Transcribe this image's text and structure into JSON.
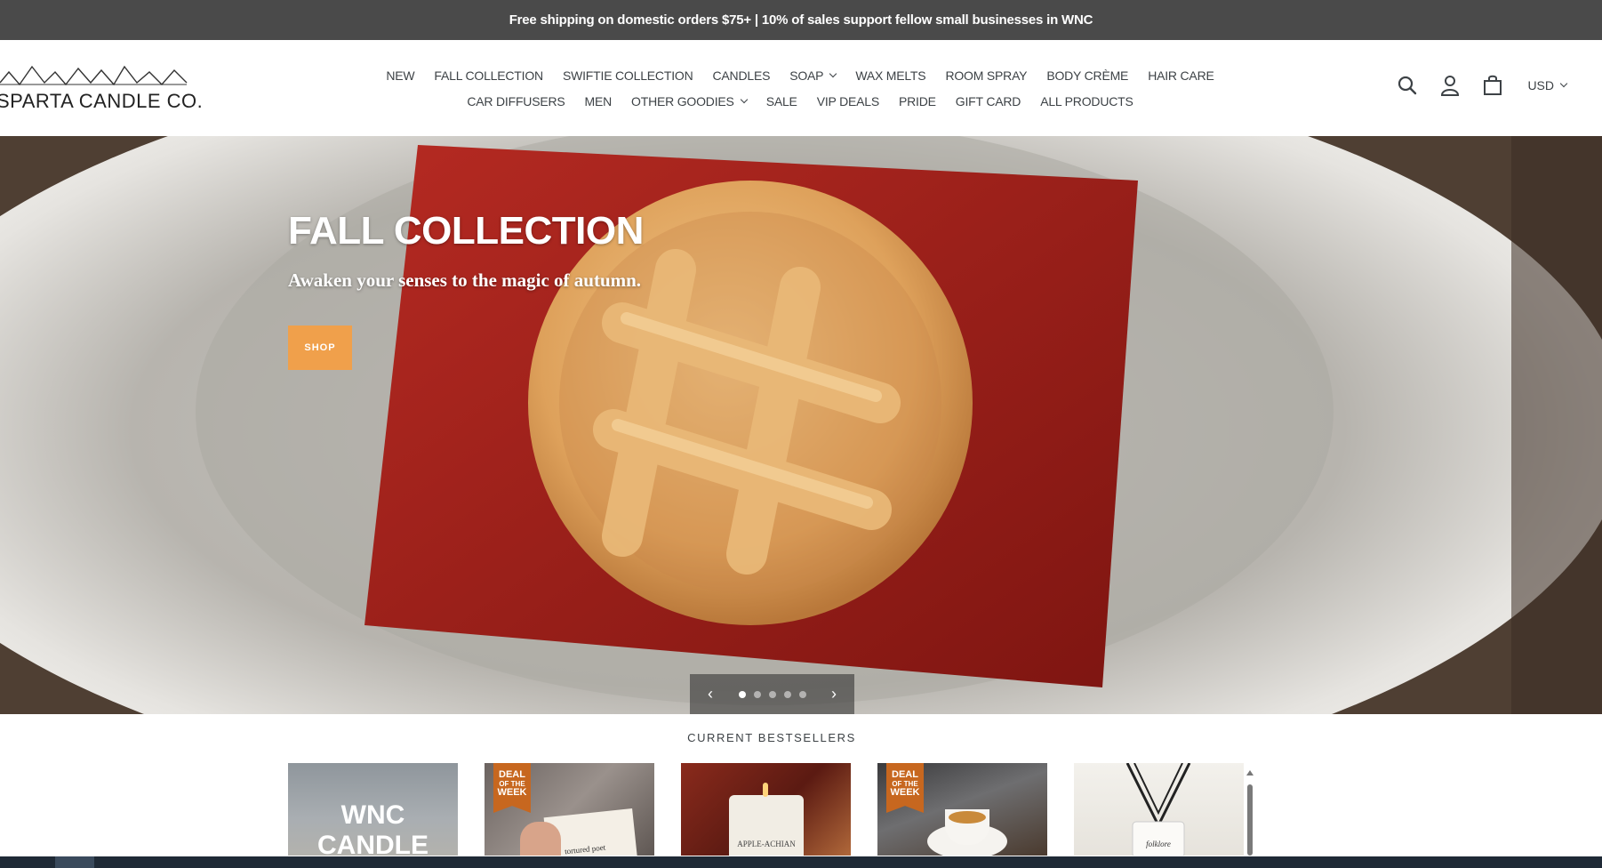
{
  "announcement": "Free shipping on domestic orders $75+ | 10% of sales support fellow small businesses in WNC",
  "brand": {
    "name": "SPARTA CANDLE CO."
  },
  "nav": {
    "row1": [
      {
        "label": "NEW",
        "dropdown": false
      },
      {
        "label": "FALL COLLECTION",
        "dropdown": false
      },
      {
        "label": "SWIFTIE COLLECTION",
        "dropdown": false
      },
      {
        "label": "CANDLES",
        "dropdown": false
      },
      {
        "label": "SOAP",
        "dropdown": true
      },
      {
        "label": "WAX MELTS",
        "dropdown": false
      },
      {
        "label": "ROOM SPRAY",
        "dropdown": false
      },
      {
        "label": "BODY CRÈME",
        "dropdown": false
      },
      {
        "label": "HAIR CARE",
        "dropdown": false
      }
    ],
    "row2": [
      {
        "label": "CAR DIFFUSERS",
        "dropdown": false
      },
      {
        "label": "MEN",
        "dropdown": false
      },
      {
        "label": "OTHER GOODIES",
        "dropdown": true
      },
      {
        "label": "SALE",
        "dropdown": false
      },
      {
        "label": "VIP DEALS",
        "dropdown": false
      },
      {
        "label": "PRIDE",
        "dropdown": false
      },
      {
        "label": "GIFT CARD",
        "dropdown": false
      },
      {
        "label": "ALL PRODUCTS",
        "dropdown": false
      }
    ]
  },
  "header_icons": [
    "search-icon",
    "account-icon",
    "cart-icon"
  ],
  "currency": "USD",
  "hero": {
    "title": "FALL COLLECTION",
    "subtitle": "Awaken your senses to the magic of autumn.",
    "button_label": "SHOP",
    "button_color": "#f0a04b",
    "slide_count": 5,
    "active_slide": 1
  },
  "bestsellers": {
    "title": "CURRENT BESTSELLERS",
    "products": [
      {
        "overlay_text": [
          "WNC",
          "CANDLE"
        ],
        "badge": null,
        "label": ""
      },
      {
        "overlay_text": [],
        "badge": {
          "line1": "DEAL",
          "line2": "OF THE",
          "line3": "WEEK"
        },
        "label": "tortured poet"
      },
      {
        "overlay_text": [],
        "badge": null,
        "label": "APPLE-ACHIAN"
      },
      {
        "overlay_text": [],
        "badge": {
          "line1": "DEAL",
          "line2": "OF THE",
          "line3": "WEEK"
        },
        "label": ""
      },
      {
        "overlay_text": [],
        "badge": null,
        "label": "folklore"
      }
    ]
  },
  "colors": {
    "announcement_bg": "#4a4a4a",
    "accent": "#f0a04b",
    "badge": "#c7671f"
  }
}
